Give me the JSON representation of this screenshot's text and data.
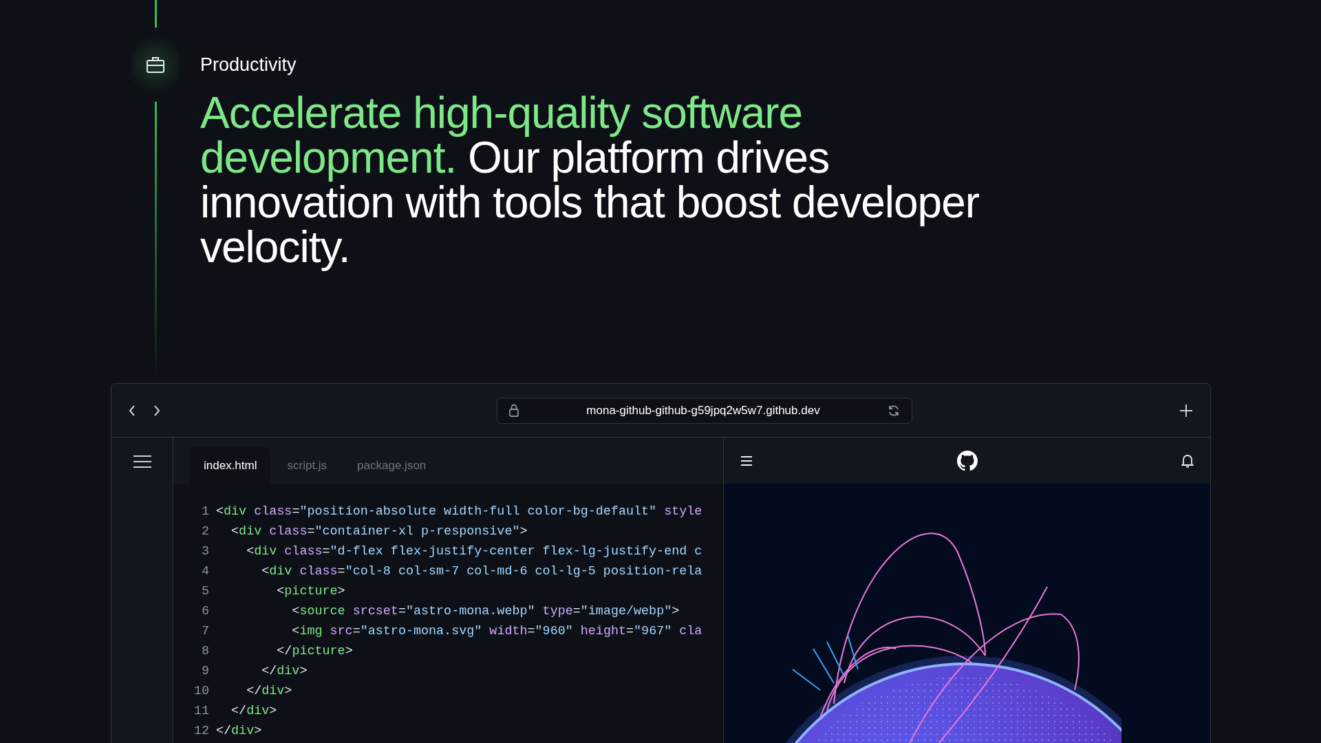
{
  "section": {
    "label": "Productivity",
    "heading": {
      "highlight": "Accelerate high-quality software development.",
      "text": "Our platform drives innovation with tools that boost developer velocity."
    }
  },
  "browser": {
    "url": "mona-github-github-g59jpq2w5w7.github.dev",
    "tabs": [
      {
        "label": "index.html",
        "selected": true
      },
      {
        "label": "script.js",
        "selected": false
      },
      {
        "label": "package.json",
        "selected": false
      }
    ],
    "code": [
      {
        "number": "1",
        "tokens": [
          {
            "kind": "punct",
            "text": "<"
          },
          {
            "kind": "tag",
            "text": "div"
          },
          {
            "kind": "attr",
            "text": " class"
          },
          {
            "kind": "punct",
            "text": "="
          },
          {
            "kind": "string",
            "text": "\"position-absolute width-full color-bg-default\""
          },
          {
            "kind": "attr",
            "text": " style"
          }
        ]
      },
      {
        "number": "2",
        "tokens": [
          {
            "kind": "punct",
            "text": "  <"
          },
          {
            "kind": "tag",
            "text": "div"
          },
          {
            "kind": "attr",
            "text": " class"
          },
          {
            "kind": "punct",
            "text": "="
          },
          {
            "kind": "string",
            "text": "\"container-xl p-responsive\""
          },
          {
            "kind": "punct",
            "text": ">"
          }
        ]
      },
      {
        "number": "3",
        "tokens": [
          {
            "kind": "punct",
            "text": "    <"
          },
          {
            "kind": "tag",
            "text": "div"
          },
          {
            "kind": "attr",
            "text": " class"
          },
          {
            "kind": "punct",
            "text": "="
          },
          {
            "kind": "string",
            "text": "\"d-flex flex-justify-center flex-lg-justify-end c"
          }
        ]
      },
      {
        "number": "4",
        "tokens": [
          {
            "kind": "punct",
            "text": "      <"
          },
          {
            "kind": "tag",
            "text": "div"
          },
          {
            "kind": "attr",
            "text": " class"
          },
          {
            "kind": "punct",
            "text": "="
          },
          {
            "kind": "string",
            "text": "\"col-8 col-sm-7 col-md-6 col-lg-5 position-rela"
          }
        ]
      },
      {
        "number": "5",
        "tokens": [
          {
            "kind": "punct",
            "text": "        <"
          },
          {
            "kind": "tag",
            "text": "picture"
          },
          {
            "kind": "punct",
            "text": ">"
          }
        ]
      },
      {
        "number": "6",
        "tokens": [
          {
            "kind": "punct",
            "text": "          <"
          },
          {
            "kind": "tag",
            "text": "source"
          },
          {
            "kind": "attr",
            "text": " srcset"
          },
          {
            "kind": "punct",
            "text": "="
          },
          {
            "kind": "string",
            "text": "\"astro-mona.webp\""
          },
          {
            "kind": "attr",
            "text": " type"
          },
          {
            "kind": "punct",
            "text": "="
          },
          {
            "kind": "string",
            "text": "\"image/webp\""
          },
          {
            "kind": "punct",
            "text": ">"
          }
        ]
      },
      {
        "number": "7",
        "tokens": [
          {
            "kind": "punct",
            "text": "          <"
          },
          {
            "kind": "tag",
            "text": "img"
          },
          {
            "kind": "attr",
            "text": " src"
          },
          {
            "kind": "punct",
            "text": "="
          },
          {
            "kind": "string",
            "text": "\"astro-mona.svg\""
          },
          {
            "kind": "attr",
            "text": " width"
          },
          {
            "kind": "punct",
            "text": "="
          },
          {
            "kind": "string",
            "text": "\"960\""
          },
          {
            "kind": "attr",
            "text": " height"
          },
          {
            "kind": "punct",
            "text": "="
          },
          {
            "kind": "string",
            "text": "\"967\""
          },
          {
            "kind": "attr",
            "text": " cla"
          }
        ]
      },
      {
        "number": "8",
        "tokens": [
          {
            "kind": "punct",
            "text": "        </"
          },
          {
            "kind": "tag",
            "text": "picture"
          },
          {
            "kind": "punct",
            "text": ">"
          }
        ]
      },
      {
        "number": "9",
        "tokens": [
          {
            "kind": "punct",
            "text": "      </"
          },
          {
            "kind": "tag",
            "text": "div"
          },
          {
            "kind": "punct",
            "text": ">"
          }
        ]
      },
      {
        "number": "10",
        "tokens": [
          {
            "kind": "punct",
            "text": "    </"
          },
          {
            "kind": "tag",
            "text": "div"
          },
          {
            "kind": "punct",
            "text": ">"
          }
        ]
      },
      {
        "number": "11",
        "tokens": [
          {
            "kind": "punct",
            "text": "  </"
          },
          {
            "kind": "tag",
            "text": "div"
          },
          {
            "kind": "punct",
            "text": ">"
          }
        ]
      },
      {
        "number": "12",
        "tokens": [
          {
            "kind": "punct",
            "text": "</"
          },
          {
            "kind": "tag",
            "text": "div"
          },
          {
            "kind": "punct",
            "text": ">"
          }
        ]
      }
    ]
  }
}
